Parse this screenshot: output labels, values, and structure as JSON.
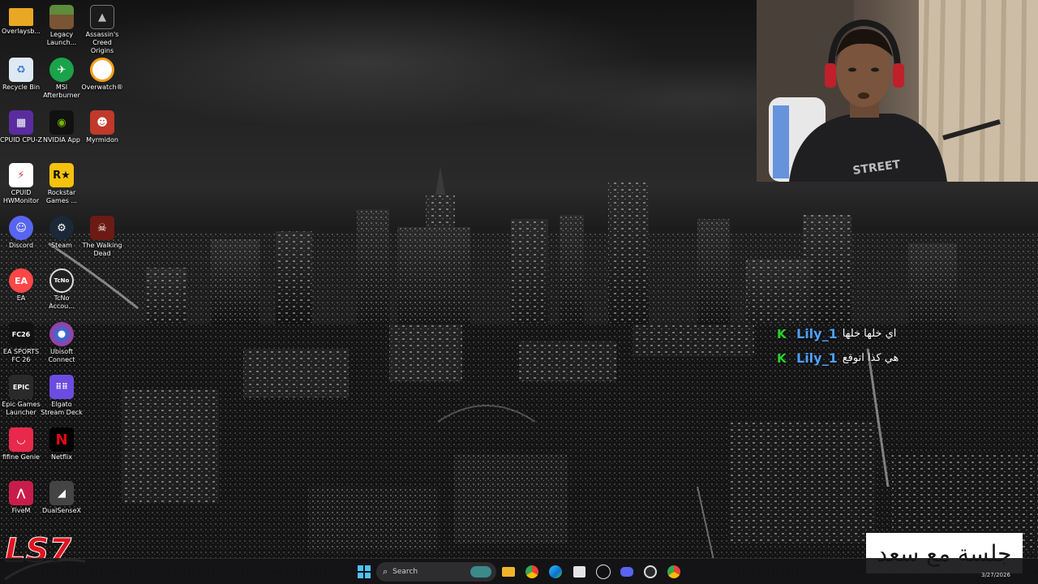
{
  "desktop_icons": [
    {
      "label": "Overlaysb...",
      "icon": "folder-icon",
      "color": "#f0b429"
    },
    {
      "label": "Legacy\nLaunch...",
      "icon": "minecraft-icon",
      "color": "#5d8c3a"
    },
    {
      "label": "Assassin's\nCreed Origins",
      "icon": "assassins-creed-icon",
      "color": "#1b1b1b"
    },
    {
      "label": "Recycle Bin",
      "icon": "recycle-bin-icon",
      "color": "#6fa6d9"
    },
    {
      "label": "MSI\nAfterburner",
      "icon": "msi-afterburner-icon",
      "color": "#1aa34a"
    },
    {
      "label": "Overwatch®",
      "icon": "overwatch-icon",
      "color": "#f99e1a"
    },
    {
      "label": "CPUID CPU-Z",
      "icon": "cpu-z-icon",
      "color": "#5a2ca0"
    },
    {
      "label": "NVIDIA App",
      "icon": "nvidia-icon",
      "color": "#76b900"
    },
    {
      "label": "Myrmidon",
      "icon": "myrmidon-icon",
      "color": "#c0392b"
    },
    {
      "label": "CPUID\nHWMonitor",
      "icon": "hwmonitor-icon",
      "color": "#d64541"
    },
    {
      "label": "Rockstar\nGames ...",
      "icon": "rockstar-icon",
      "color": "#f4c20d"
    },
    {
      "label": "Discord",
      "icon": "discord-icon",
      "color": "#5865f2"
    },
    {
      "label": "Steam",
      "icon": "steam-icon",
      "color": "#1b2838"
    },
    {
      "label": "The Walking\nDead",
      "icon": "walking-dead-icon",
      "color": "#6b1b14"
    },
    {
      "label": "EA",
      "icon": "ea-icon",
      "color": "#ff4747"
    },
    {
      "label": "TcNo\nAccou...",
      "icon": "tcno-icon",
      "color": "#222222"
    },
    {
      "label": "EA SPORTS\nFC 26",
      "icon": "ea-sports-fc-icon",
      "color": "#111111"
    },
    {
      "label": "Ubisoft\nConnect",
      "icon": "ubisoft-icon",
      "color": "#1a1a1a"
    },
    {
      "label": "Epic Games\nLauncher",
      "icon": "epic-games-icon",
      "color": "#2a2a2a"
    },
    {
      "label": "Elgato\nStream Deck",
      "icon": "stream-deck-icon",
      "color": "#6c4ce0"
    },
    {
      "label": "fifine Genie",
      "icon": "fifine-icon",
      "color": "#e8294c"
    },
    {
      "label": "Netflix",
      "icon": "netflix-icon",
      "color": "#e50914"
    },
    {
      "label": "FiveM",
      "icon": "fivem-icon",
      "color": "#c81d4b"
    },
    {
      "label": "DualSenseX",
      "icon": "dualsensex-icon",
      "color": "#444444"
    }
  ],
  "chat": [
    {
      "badge": "K",
      "user": "Lily_1",
      "message": "اي خلها خلها"
    },
    {
      "badge": "K",
      "user": "Lily_1",
      "message": "هي كذا اتوقع"
    }
  ],
  "banner": {
    "text": "جلسة مع سعد"
  },
  "logo": {
    "text": "LS7",
    "color": "#e0141e"
  },
  "taskbar": {
    "search_placeholder": "Search",
    "clock_date": "3/27/2026",
    "pinned": [
      "file-explorer-icon",
      "chrome-icon",
      "edge-icon",
      "store-icon",
      "streamlabs-icon",
      "discord-icon",
      "obs-icon",
      "chrome-alt-icon"
    ]
  },
  "colors": {
    "chat_username": "#4fa0ff",
    "chat_badge": "#2bd32b",
    "taskbar_bg": "#141416"
  }
}
